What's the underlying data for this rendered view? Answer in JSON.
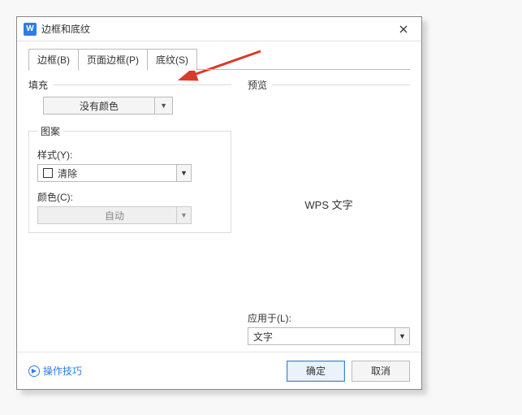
{
  "title": "边框和底纹",
  "tabs": {
    "border": "边框(B)",
    "pageBorder": "页面边框(P)",
    "shading": "底纹(S)"
  },
  "left": {
    "fill_label": "填充",
    "fill_value": "没有颜色",
    "pattern_legend": "图案",
    "style_label": "样式(Y):",
    "style_value": "清除",
    "color_label": "颜色(C):",
    "color_value": "自动"
  },
  "right": {
    "preview_label": "预览",
    "preview_text": "WPS 文字",
    "apply_label": "应用于(L):",
    "apply_value": "文字"
  },
  "footer": {
    "tips": "操作技巧",
    "ok": "确定",
    "cancel": "取消"
  }
}
